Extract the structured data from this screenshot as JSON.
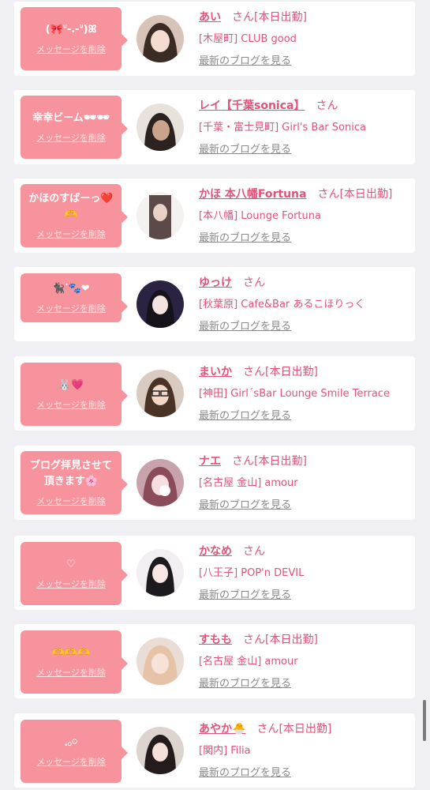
{
  "entries": [
    {
      "message": "(🎀ᐡ-.-ᐡ)ꕤ",
      "delete_label": "メッセージを削除",
      "name": "あい",
      "san": "さん",
      "status": "[本日出勤]",
      "shop": "[木屋町] CLUB good",
      "blog_link": "最新のブログを見る",
      "avatar": "avatar-1"
    },
    {
      "message": "幸幸ビーム🕶🕶",
      "delete_label": "メッセージを削除",
      "name": "レイ【千葉sonica】",
      "san": "さん",
      "status": "",
      "shop": "[千葉・富士見町] Girl's Bar Sonica",
      "blog_link": "最新のブログを見る",
      "avatar": "avatar-2"
    },
    {
      "message": "かほのすばーっ❤️\n🫶",
      "delete_label": "メッセージを削除",
      "name": "かほ 本八幡Fortuna",
      "san": "さん",
      "status": "[本日出勤]",
      "shop": "[本八幡] Lounge Fortuna",
      "blog_link": "最新のブログを見る",
      "avatar": "avatar-3"
    },
    {
      "message": "🐈‍⬛ᐝ🐾❤",
      "delete_label": "メッセージを削除",
      "name": "ゆっけ",
      "san": "さん",
      "status": "",
      "shop": "[秋葉原] Cafe&Bar あるこほりっく",
      "blog_link": "最新のブログを見る",
      "avatar": "avatar-4"
    },
    {
      "message": "🐰💗",
      "delete_label": "メッセージを削除",
      "name": "まいか",
      "san": "さん",
      "status": "[本日出勤]",
      "shop": "[神田] Girl´sBar Lounge Smile Terrace",
      "blog_link": "最新のブログを見る",
      "avatar": "avatar-5"
    },
    {
      "message": "ブログ拝見させて\n頂きます🌸",
      "delete_label": "メッセージを削除",
      "name": "ナエ",
      "san": "さん",
      "status": "[本日出勤]",
      "shop": "[名古屋 金山] amour",
      "blog_link": "最新のブログを見る",
      "avatar": "avatar-6"
    },
    {
      "message": "♡",
      "delete_label": "メッセージを削除",
      "name": "かなめ",
      "san": "さん",
      "status": "",
      "shop": "[八王子] POP'n DEVIL",
      "blog_link": "最新のブログを見る",
      "avatar": "avatar-7"
    },
    {
      "message": "🫶🫶🫶",
      "delete_label": "メッセージを削除",
      "name": "すもも",
      "san": "さん",
      "status": "[本日出勤]",
      "shop": "[名古屋 金山] amour",
      "blog_link": "最新のブログを見る",
      "avatar": "avatar-8"
    },
    {
      "message": "𓈒𓂂𓏸",
      "delete_label": "メッセージを削除",
      "name": "あやか🐣",
      "san": "さん",
      "status": "[本日出勤]",
      "shop": "[関内] Filia",
      "blog_link": "最新のブログを見る",
      "avatar": "avatar-9"
    }
  ],
  "colors": {
    "bubble": "#f7939d",
    "accent": "#e2527a",
    "link_gray": "#8a8a8a",
    "background": "#f0eff3"
  }
}
